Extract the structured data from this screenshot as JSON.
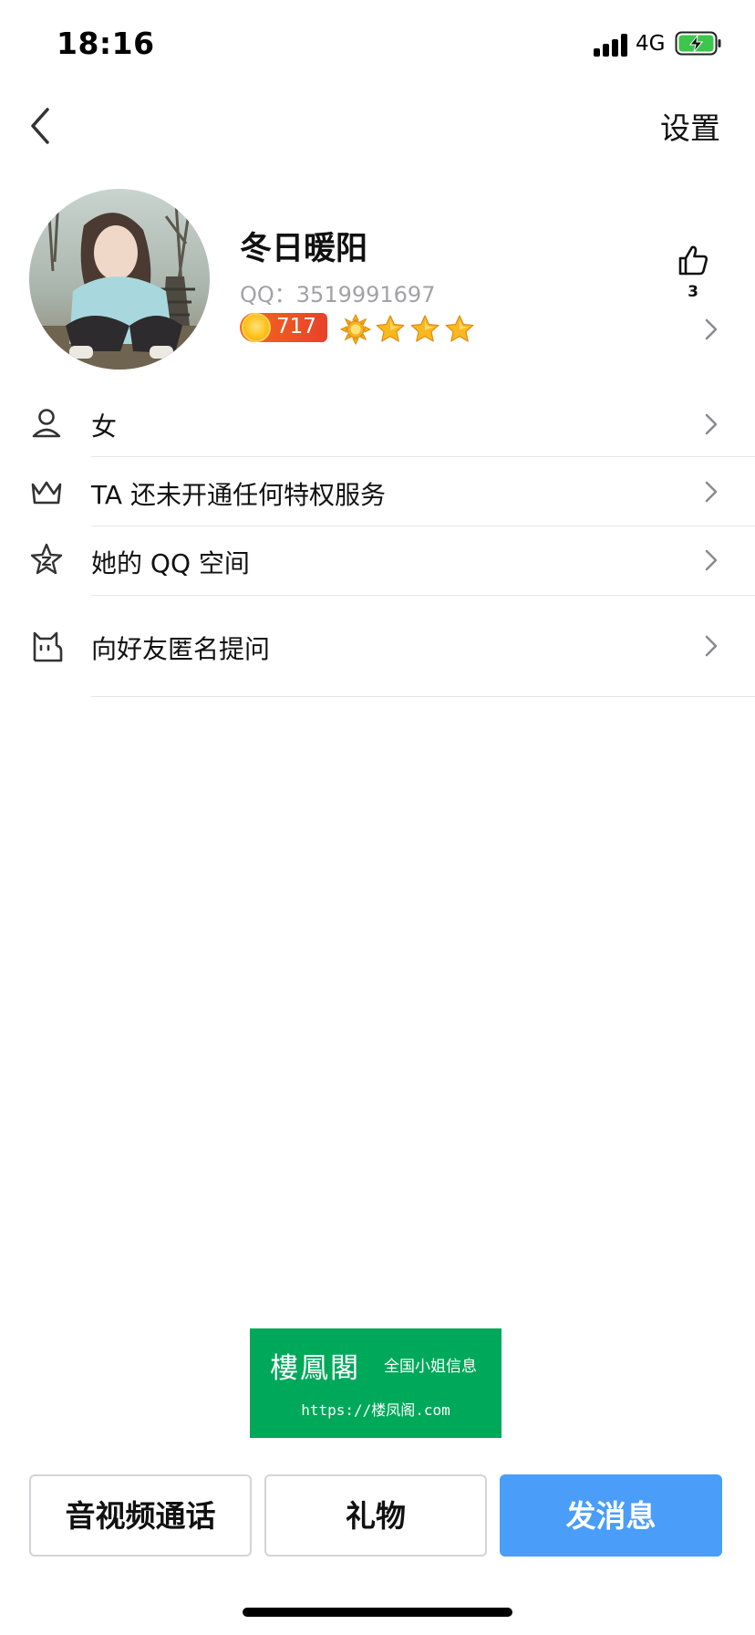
{
  "status_bar": {
    "time": "18:16",
    "network": "4G"
  },
  "nav": {
    "settings_label": "设置"
  },
  "profile": {
    "nickname": "冬日暖阳",
    "qq_number": "QQ：3519991697",
    "level_value": "717",
    "level_icons": [
      "sun-icon",
      "star-icon",
      "star-icon",
      "star-icon"
    ],
    "likes": "3"
  },
  "info_rows": [
    {
      "label": "女",
      "icon": "person-icon"
    },
    {
      "label": "TA 还未开通任何特权服务",
      "icon": "crown-icon"
    },
    {
      "label": "她的 QQ 空间",
      "icon": "qzone-star-icon"
    },
    {
      "label": "向好友匿名提问",
      "icon": "cat-icon"
    }
  ],
  "ad_banner": {
    "title": "樓鳳閣",
    "subtitle": "全国小姐信息",
    "url": "https://楼凤阁.com"
  },
  "actions": {
    "call": "音视频通话",
    "gift": "礼物",
    "message": "发消息"
  },
  "colors": {
    "primary": "#4a9df8",
    "ad_green": "#00a85a",
    "divider": "#e5e5e8",
    "muted_text": "#a2a2a6"
  }
}
